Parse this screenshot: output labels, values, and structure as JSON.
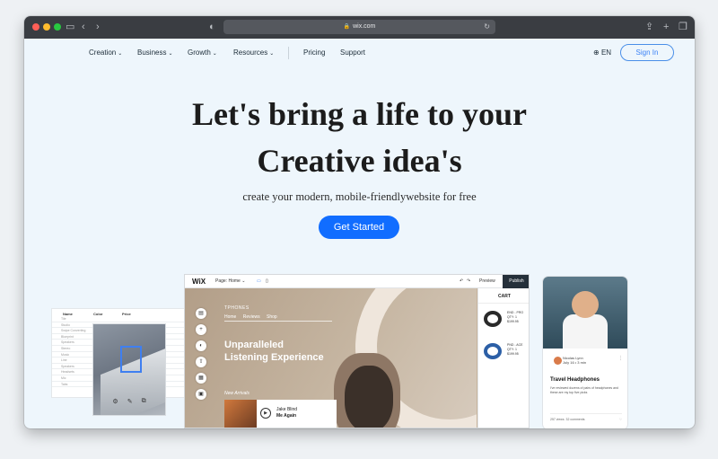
{
  "browser": {
    "url": "wix.com"
  },
  "nav": {
    "items": [
      {
        "label": "Creation"
      },
      {
        "label": "Business"
      },
      {
        "label": "Growth"
      },
      {
        "label": "Resources"
      },
      {
        "label": "Pricing"
      },
      {
        "label": "Support"
      }
    ],
    "language": "EN",
    "sign_in": "Sign In"
  },
  "hero": {
    "title_line1": "Let's bring a life to your",
    "title_line2": "Creative idea's",
    "subtitle": "create your modern, mobile-friendlywebsite for free",
    "cta": "Get Started"
  },
  "table_card": {
    "headers": [
      "Name",
      "Color",
      "Price"
    ],
    "rows": [
      "Tile",
      "Studio",
      "Swipe Converting",
      "Blueprint",
      "Speakers",
      "Stereo",
      "Music",
      "Line",
      "Speakers",
      "Headsets",
      "Mic",
      "Tabs"
    ]
  },
  "editor": {
    "logo": "WiX",
    "page_selector": "Page: Home",
    "preview": "Preview",
    "publish": "Publish",
    "site": {
      "brand": "TPHONES",
      "menu": [
        "Home",
        "Reviews",
        "Shop"
      ],
      "headline_line1": "Unparalleled",
      "headline_line2": "Listening Experience",
      "new_arrivals": "New Arrivals",
      "track_artist": "Jake Blind",
      "track_title": "Me Again"
    },
    "cart": {
      "title": "CART",
      "items": [
        {
          "name": "END - PRO",
          "qty": "QTY: 1",
          "price": "$199.95"
        },
        {
          "name": "PND - ACE",
          "qty": "QTY: 1",
          "price": "$199.95"
        }
      ]
    }
  },
  "phone": {
    "author": "Nicolas Lynn",
    "date": "July 16 • 3 min",
    "post_title": "Travel Headphones",
    "post_desc": "I've reviewed dozens of pairs of headphones and these are my top five picks",
    "views": "257 views",
    "comments": "32 comments"
  }
}
